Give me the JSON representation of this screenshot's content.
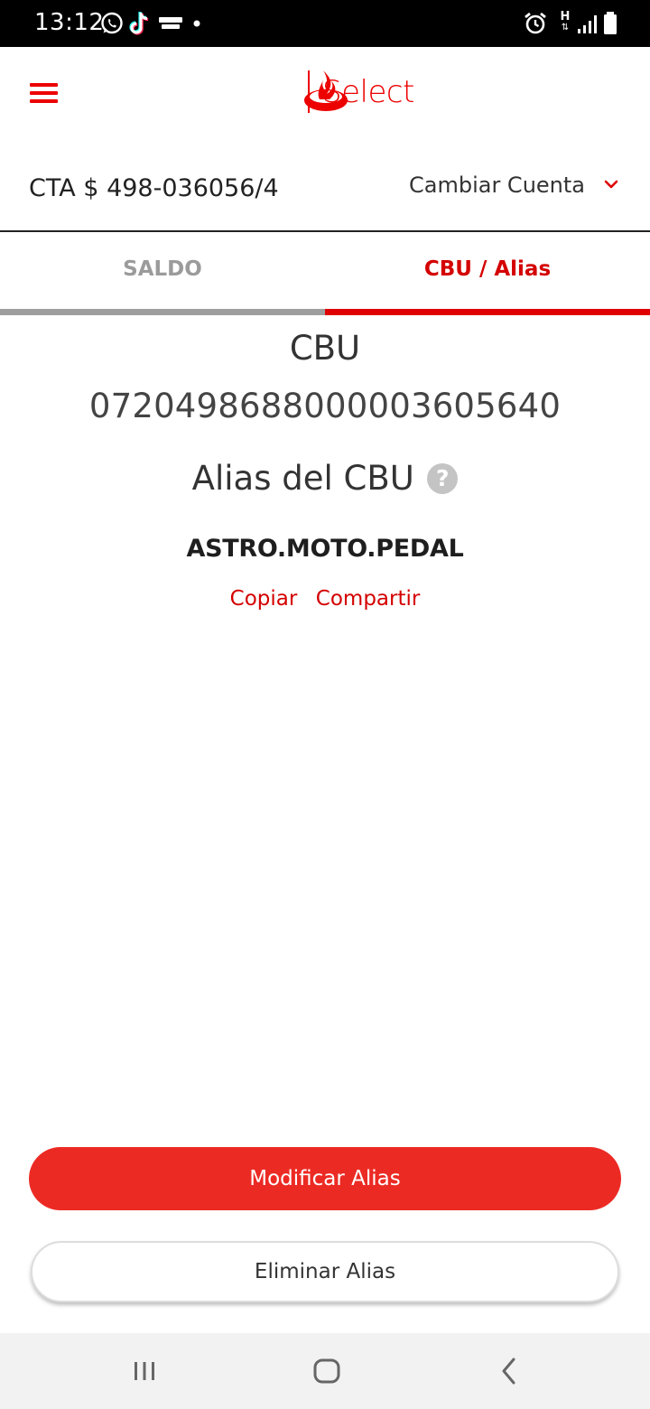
{
  "status_bar": {
    "time": "13:12",
    "notification_icons": [
      "whatsapp-icon",
      "tiktok-icon",
      "royal-match-icon",
      "dot-icon"
    ],
    "system_icons": [
      "alarm-icon",
      "h-plus-network-icon",
      "signal-icon",
      "battery-icon"
    ],
    "network_label": "H"
  },
  "header": {
    "brand_name": "Select",
    "menu_icon": "hamburger-menu-icon",
    "logo_icon": "santander-flame-icon",
    "brand_color": "#ec0000"
  },
  "account": {
    "number": "CTA $ 498-036056/4",
    "change_label": "Cambiar Cuenta",
    "change_icon": "chevron-down-icon"
  },
  "tabs": [
    {
      "label": "SALDO",
      "active": false
    },
    {
      "label": "CBU / Alias",
      "active": true
    }
  ],
  "cbu": {
    "title": "CBU",
    "number": "0720498688000003605640"
  },
  "alias": {
    "title": "Alias del CBU",
    "help_icon": "question-circle-icon",
    "help_glyph": "?",
    "value": "ASTRO.MOTO.PEDAL",
    "copy_label": "Copiar",
    "share_label": "Compartir"
  },
  "actions": {
    "modify_label": "Modificar Alias",
    "delete_label": "Eliminar Alias",
    "primary_color": "#ec2a24"
  },
  "nav_bar": {
    "buttons": [
      "recent-apps-icon",
      "home-icon",
      "back-icon"
    ]
  }
}
